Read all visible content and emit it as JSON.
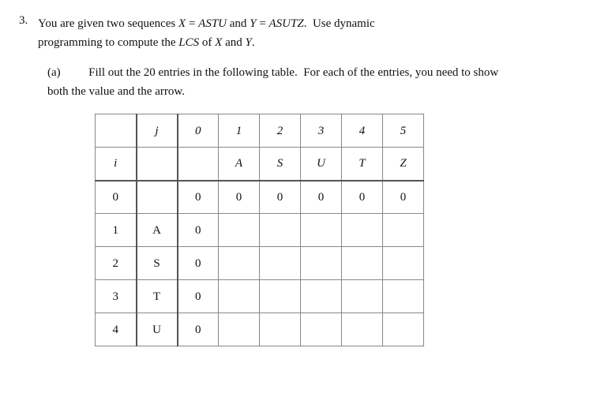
{
  "problem": {
    "number": "3.",
    "line1": "You are given two sequences ",
    "x_var": "X",
    "eq1": " = ",
    "x_val": "ASTU",
    "and": " and ",
    "y_var": "Y",
    "eq2": " = ",
    "y_val": "ASUTZ",
    "period": ".",
    "instruction": " Use dynamic programming to compute the ",
    "lcs": "LCS",
    "of_xy": " of ",
    "x2": "X",
    "and2": " and ",
    "y2": "Y",
    "dot": "."
  },
  "part_a": {
    "label": "(a)",
    "text1": "Fill out the 20 entries in the following table. For each of the entries, you need to show",
    "text2": "both the value and the arrow."
  },
  "table": {
    "j_label": "j",
    "i_label": "i",
    "col_headers": [
      "0",
      "1",
      "2",
      "3",
      "4",
      "5"
    ],
    "y_chars": [
      "",
      "A",
      "S",
      "U",
      "T",
      "Z"
    ],
    "rows": [
      {
        "i": "0",
        "char": "",
        "vals": [
          "0",
          "0",
          "0",
          "0",
          "0",
          "0"
        ]
      },
      {
        "i": "1",
        "char": "A",
        "vals": [
          "0",
          "",
          "",
          "",
          "",
          ""
        ]
      },
      {
        "i": "2",
        "char": "S",
        "vals": [
          "0",
          "",
          "",
          "",
          "",
          ""
        ]
      },
      {
        "i": "3",
        "char": "T",
        "vals": [
          "0",
          "",
          "",
          "",
          "",
          ""
        ]
      },
      {
        "i": "4",
        "char": "U",
        "vals": [
          "0",
          "",
          "",
          "",
          "",
          ""
        ]
      }
    ]
  }
}
